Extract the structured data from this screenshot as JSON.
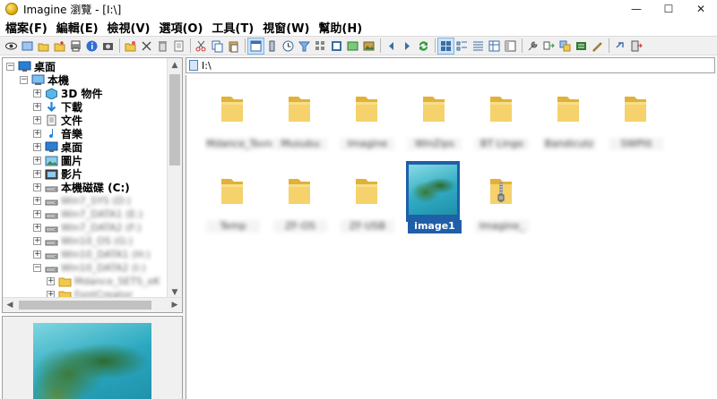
{
  "window": {
    "title": "Imagine 瀏覽 - [I:\\]"
  },
  "window_controls": {
    "minimize": "—",
    "maximize": "☐",
    "close": "✕"
  },
  "menu": [
    "檔案(F)",
    "編輯(E)",
    "檢視(V)",
    "選項(O)",
    "工具(T)",
    "視窗(W)",
    "幫助(H)"
  ],
  "toolbar_icons": [
    "eye-icon",
    "thumbnail-view-icon",
    "open-folder-icon",
    "new-folder-icon",
    "print-icon",
    "info-icon",
    "slideshow-icon",
    "new-folder-star-icon",
    "cut-icon",
    "delete-icon",
    "properties-icon",
    "scissors-icon",
    "copy-icon",
    "paste-icon",
    "view-window-icon",
    "split-icon",
    "clock-icon",
    "filter-icon",
    "grid-icon",
    "fullscreen-icon",
    "image-icon",
    "photo-icon",
    "previous-icon",
    "next-icon",
    "refresh-icon",
    "large-icons-icon",
    "small-icons-icon",
    "list-icon",
    "details-icon",
    "panel-icon",
    "tools-icon",
    "convert-icon",
    "batch-icon",
    "capture-icon",
    "rename-icon",
    "link-icon",
    "exit-icon"
  ],
  "tree": {
    "items": [
      {
        "label": "桌面",
        "icon": "desktop-icon",
        "level": 0,
        "expanded": true
      },
      {
        "label": "本機",
        "icon": "computer-icon",
        "level": 1,
        "expanded": true
      },
      {
        "label": "3D 物件",
        "icon": "cube-icon",
        "level": 2
      },
      {
        "label": "下載",
        "icon": "download-icon",
        "level": 2
      },
      {
        "label": "文件",
        "icon": "document-icon",
        "level": 2
      },
      {
        "label": "音樂",
        "icon": "music-icon",
        "level": 2
      },
      {
        "label": "桌面",
        "icon": "desktop-icon",
        "level": 2
      },
      {
        "label": "圖片",
        "icon": "pictures-icon",
        "level": 2
      },
      {
        "label": "影片",
        "icon": "video-icon",
        "level": 2
      },
      {
        "label": "本機磁碟 (C:)",
        "icon": "drive-icon",
        "level": 2
      },
      {
        "label": "Win7_SYS (D:)",
        "icon": "drive-icon",
        "level": 2,
        "blurred": true
      },
      {
        "label": "Win7_DATA1 (E:)",
        "icon": "drive-icon",
        "level": 2,
        "blurred": true
      },
      {
        "label": "Win7_DATA2 (F:)",
        "icon": "drive-icon",
        "level": 2,
        "blurred": true
      },
      {
        "label": "Win10_OS (G:)",
        "icon": "drive-icon",
        "level": 2,
        "blurred": true
      },
      {
        "label": "Win10_DATA1 (H:)",
        "icon": "drive-icon",
        "level": 2,
        "blurred": true
      },
      {
        "label": "Win10_DATA2 (I:)",
        "icon": "drive-icon",
        "level": 2,
        "blurred": true,
        "expanded": true
      },
      {
        "label": "Mdance_SETS_eK",
        "icon": "folder-icon",
        "level": 3,
        "blurred": true
      },
      {
        "label": "FontCreator",
        "icon": "folder-icon",
        "level": 3,
        "blurred": true
      }
    ]
  },
  "path": {
    "value": "I:\\"
  },
  "files": [
    {
      "name": "Mdance_Tools",
      "type": "folder"
    },
    {
      "name": "Musubu",
      "type": "folder"
    },
    {
      "name": "Imagine",
      "type": "folder"
    },
    {
      "name": "WinZips",
      "type": "folder"
    },
    {
      "name": "BT Lingo",
      "type": "folder"
    },
    {
      "name": "Bandicutz",
      "type": "folder"
    },
    {
      "name": "SWPlit",
      "type": "folder"
    },
    {
      "name": "Temp",
      "type": "folder"
    },
    {
      "name": "ZF-OS",
      "type": "folder"
    },
    {
      "name": "ZF-USB",
      "type": "folder"
    },
    {
      "name": "image1",
      "type": "image",
      "selected": true
    },
    {
      "name": "Imagine_",
      "type": "zip-folder"
    }
  ],
  "colors": {
    "selection": "#1f5fa8",
    "folder": "#f2c94c",
    "folder_dark": "#e0b23a"
  }
}
